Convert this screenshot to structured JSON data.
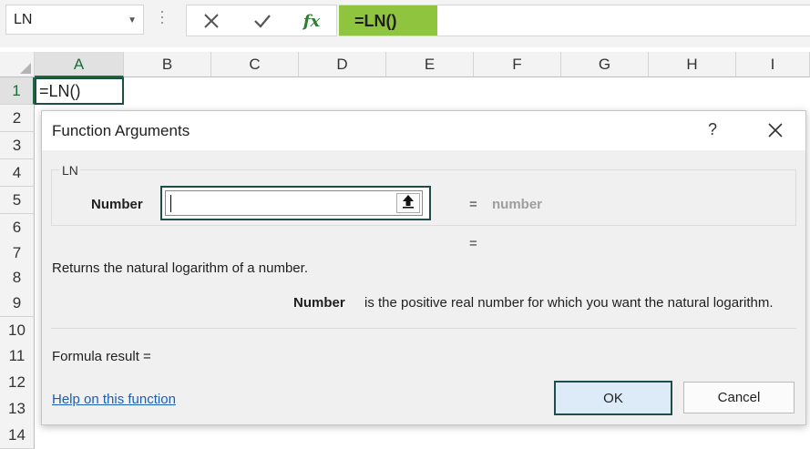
{
  "formula_bar": {
    "name_box": "LN",
    "formula": "=LN()",
    "fx_label": "fx",
    "icons": [
      "cancel-icon",
      "enter-check-icon",
      "insert-function-icon"
    ]
  },
  "grid": {
    "columns": [
      "A",
      "B",
      "C",
      "D",
      "E",
      "F",
      "G",
      "H",
      "I"
    ],
    "rows": [
      "1",
      "2",
      "3",
      "4",
      "5",
      "6",
      "7",
      "8",
      "9",
      "10",
      "11",
      "12",
      "13",
      "14"
    ],
    "active_cell_value": "=LN()"
  },
  "dialog": {
    "title": "Function Arguments",
    "help_glyph": "?",
    "function_name": "LN",
    "argument_label": "Number",
    "argument_value": "",
    "equals": "=",
    "argument_result": "number",
    "equals_2": "=",
    "description": "Returns the natural logarithm of a number.",
    "param_name": "Number",
    "param_description": "is the positive real number for which you want the natural logarithm.",
    "formula_result_label": "Formula result =",
    "help_link": "Help on this function",
    "ok_label": "OK",
    "cancel_label": "Cancel"
  },
  "colors": {
    "formula_highlight": "#8fc43f",
    "active_border": "#1f4e4a",
    "ok_fill": "#dcebf7",
    "link": "#1a5fb4"
  }
}
